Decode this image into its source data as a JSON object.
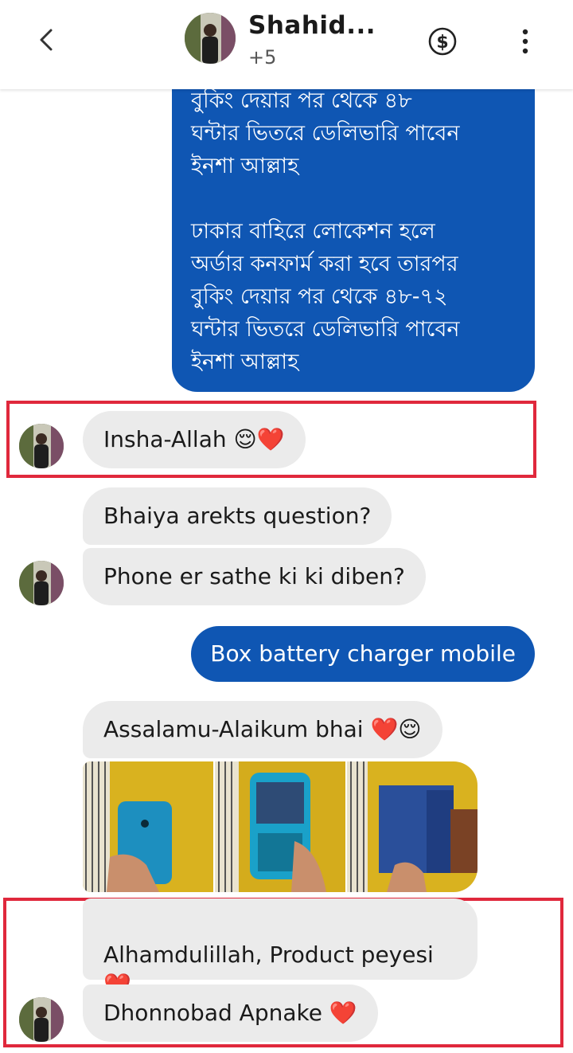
{
  "header": {
    "back_icon": "chevron-left-icon",
    "contact_name": "Shahid...",
    "participants_extra": "+5",
    "payment_icon": "dollar-circle-icon",
    "more_icon": "vertical-dots-icon"
  },
  "messages": {
    "outgoing_booking": {
      "text_cut": "বুকিং দেয়ার পর থেকে ৪৮",
      "text": "ঘন্টার ভিতরে ডেলিভারি পাবেন\nইনশা আল্লাহ\n\nঢাকার বাহিরে লোকেশন হলে\nঅর্ডার কনফার্ম করা হবে তারপর\nবুকিং দেয়ার পর থেকে ৪৮-৭২\nঘন্টার ভিতরে ডেলিভারি পাবেন\nইনশা আল্লাহ"
    },
    "incoming_insha": {
      "text": "Insha-Allah 😌❤️"
    },
    "incoming_question": {
      "text": "Bhaiya arekts question?"
    },
    "incoming_phone": {
      "text": "Phone er sathe ki ki diben?"
    },
    "outgoing_box": {
      "text": "Box battery charger mobile"
    },
    "incoming_salam": {
      "text": "Assalamu-Alaikum bhai ❤️😌"
    },
    "incoming_photos": [
      "blue-nokia-phone-photo",
      "nokia-qwerty-phone-photo",
      "nokia-box-photo"
    ],
    "incoming_product": {
      "text": "Alhamdulillah, Product peyesi\n❤️"
    },
    "incoming_thanks": {
      "text": "Dhonnobad Apnake ❤️"
    }
  },
  "colors": {
    "outgoing_bubble": "#0f56b3",
    "incoming_bubble": "#ebebeb",
    "highlight_border": "#e0283c"
  }
}
